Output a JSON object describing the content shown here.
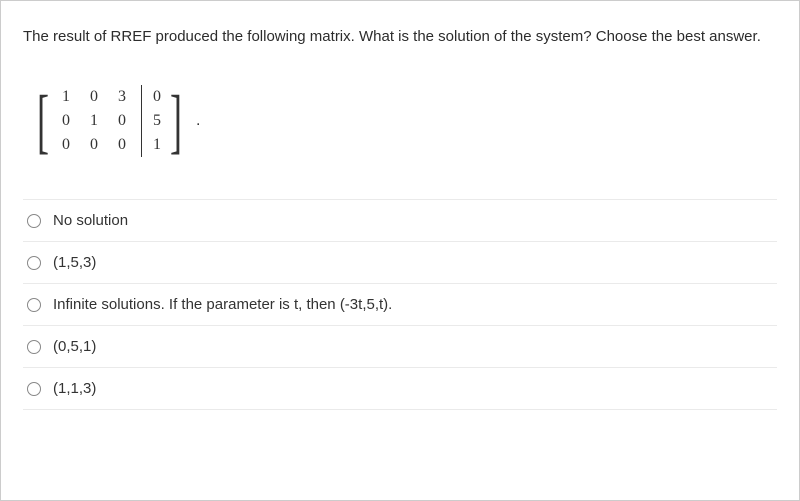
{
  "question": "The result of RREF produced the following matrix. What is the solution of the system? Choose the best answer.",
  "matrix": {
    "rows": [
      {
        "a": "1",
        "b": "0",
        "c": "3",
        "d": "0"
      },
      {
        "a": "0",
        "b": "1",
        "c": "0",
        "d": "5"
      },
      {
        "a": "0",
        "b": "0",
        "c": "0",
        "d": "1"
      }
    ]
  },
  "period": ".",
  "options": [
    {
      "label": "No solution"
    },
    {
      "label": "(1,5,3)"
    },
    {
      "label": "Infinite solutions. If the parameter is t, then (-3t,5,t)."
    },
    {
      "label": "(0,5,1)"
    },
    {
      "label": "(1,1,3)"
    }
  ]
}
